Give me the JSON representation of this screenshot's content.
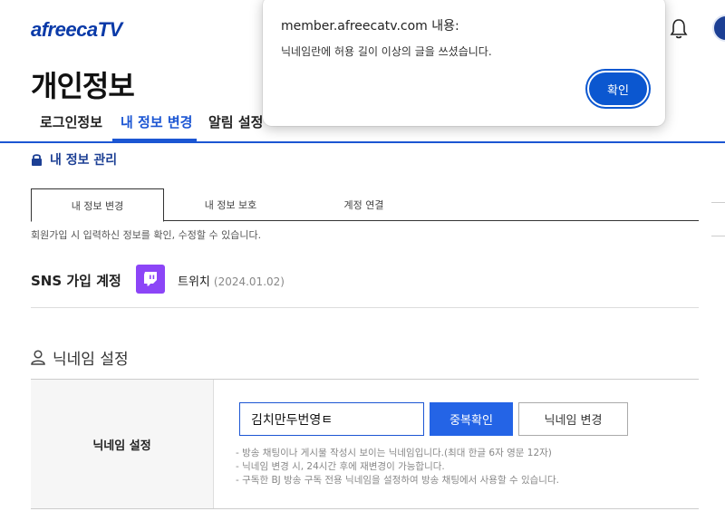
{
  "header": {
    "logo_text": "afreecaTV"
  },
  "page": {
    "title": "개인정보"
  },
  "topnav": {
    "tabs": [
      {
        "label": "로그인정보"
      },
      {
        "label": "내 정보 변경"
      },
      {
        "label": "알림 설정"
      }
    ]
  },
  "section": {
    "title": "내 정보 관리"
  },
  "subtabs": {
    "items": [
      {
        "label": "내 정보 변경"
      },
      {
        "label": "내 정보 보호"
      },
      {
        "label": "계정 연결"
      }
    ],
    "description": "회원가입 시 입력하신 정보를 확인, 수정할 수 있습니다."
  },
  "sns": {
    "label": "SNS 가입 계정",
    "service": "트위치",
    "date": "(2024.01.02)"
  },
  "nickname": {
    "section_title": "닉네임 설정",
    "field_label": "닉네임 설정",
    "input_value": "김치만두번영ㅌ",
    "dup_check_label": "중복확인",
    "change_label": "닉네임 변경",
    "hints": [
      "- 방송 채팅이나 게시물 작성시 보이는 닉네임입니다.(최대 한글 6자 영문 12자)",
      "- 닉네임 변경 시, 24시간 후에 재변경이 가능합니다.",
      "- 구독한 BJ 방송 구독 전용 닉네임을 설정하여 방송 채팅에서 사용할 수 있습니다."
    ]
  },
  "dialog": {
    "title": "member.afreecatv.com 내용:",
    "message": "닉네임란에 허용 길이 이상의 글을 쓰셨습니다.",
    "ok_label": "확인"
  },
  "colors": {
    "brand_blue": "#1c56d3",
    "dialog_button": "#0b57d0",
    "twitch_purple": "#8c45f7"
  }
}
